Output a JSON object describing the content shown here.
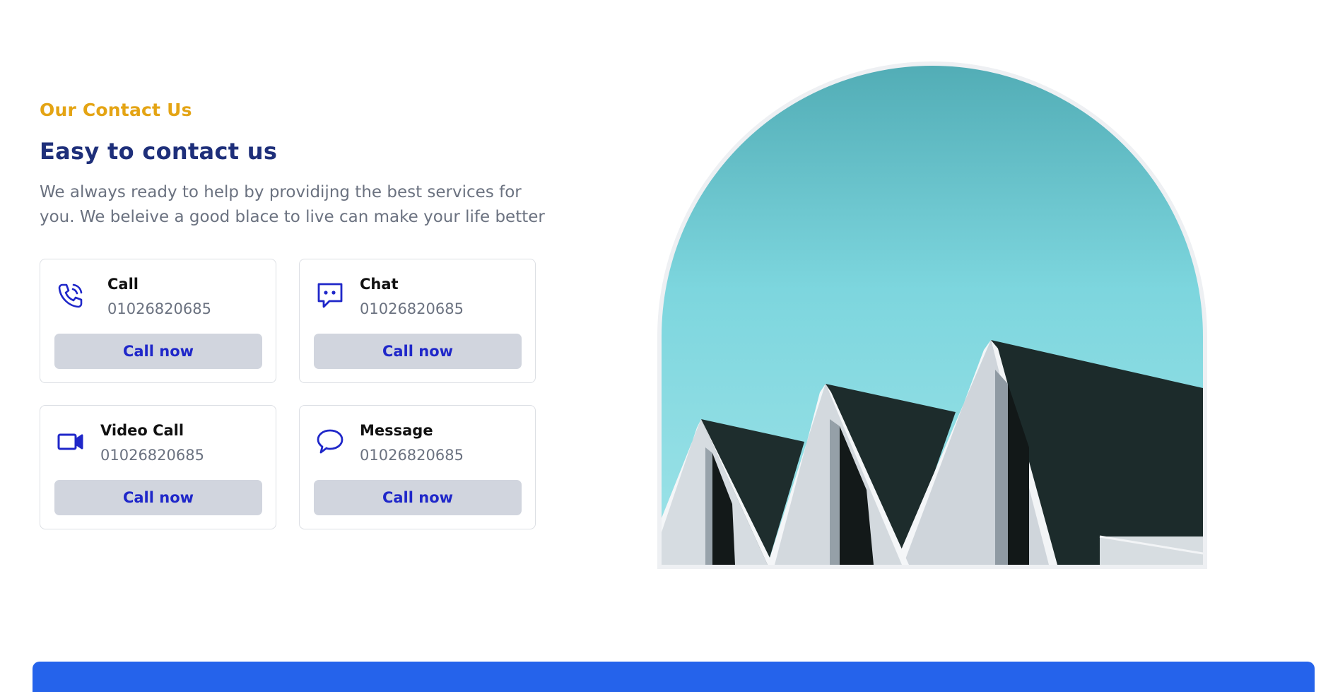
{
  "section": {
    "eyebrow": "Our Contact Us",
    "title": "Easy to contact us",
    "description_line1": "We always ready to help by providijng the best services for",
    "description_line2": "you. We beleive a good blace to live can make your life better"
  },
  "cards": [
    {
      "label": "Call",
      "number": "01026820685",
      "button": "Call now",
      "icon": "phone-icon"
    },
    {
      "label": "Chat",
      "number": "01026820685",
      "button": "Call now",
      "icon": "chat-icon"
    },
    {
      "label": "Video Call",
      "number": "01026820685",
      "button": "Call now",
      "icon": "video-icon"
    },
    {
      "label": "Message",
      "number": "01026820685",
      "button": "Call now",
      "icon": "message-icon"
    }
  ],
  "colors": {
    "accent": "#e4a414",
    "heading": "#1e2f7a",
    "icon": "#1f27c9",
    "footer": "#2563eb"
  }
}
